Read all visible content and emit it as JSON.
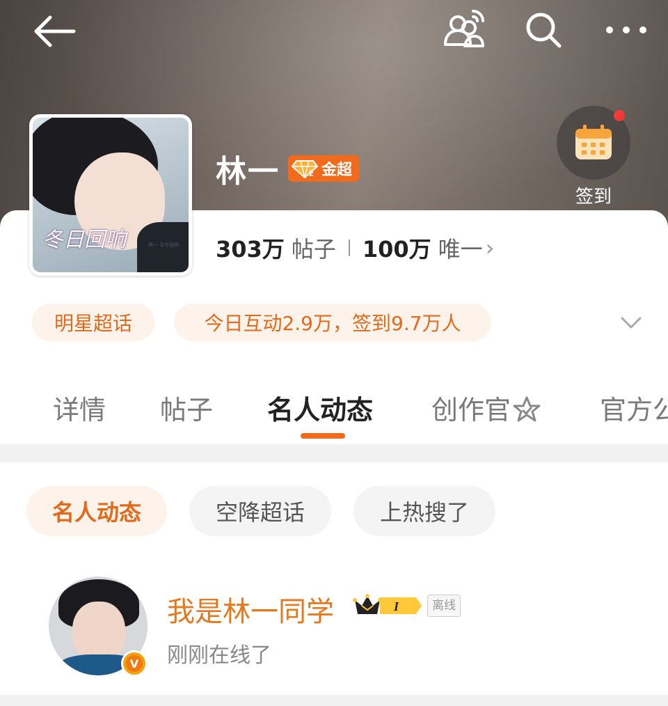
{
  "header": {
    "back_icon": "arrow-left-icon",
    "follow_icon": "users-plus-icon",
    "search_icon": "search-icon",
    "more_icon": "more-horizontal-icon"
  },
  "topic": {
    "name": "林一",
    "badge_label": "金超",
    "badge_icon": "diamond-level-icon",
    "checkin_label": "签到",
    "checkin_icon": "calendar-icon",
    "cover_title": "冬日回响",
    "cover_note": "林一 寻冬回响",
    "posts_count": "303万",
    "posts_label": "帖子",
    "members_count": "100万",
    "members_label": "唯一",
    "members_chevron": "›",
    "category_chip": "明星超话",
    "activity_chip": "今日互动2.9万，签到9.7万人"
  },
  "tabs": [
    {
      "label": "详情",
      "active": false
    },
    {
      "label": "帖子",
      "active": false
    },
    {
      "label": "名人动态",
      "active": true
    },
    {
      "label": "创作官",
      "active": false
    },
    {
      "label": "官方公",
      "active": false
    }
  ],
  "filters": [
    {
      "label": "名人动态",
      "active": true
    },
    {
      "label": "空降超话",
      "active": false
    },
    {
      "label": "上热搜了",
      "active": false
    }
  ],
  "celebrity": {
    "name": "我是林一同学",
    "level": "I",
    "level_icon": "crown-level-icon",
    "verified_mark": "V",
    "presence": "离线",
    "status": "刚刚在线了"
  },
  "colors": {
    "accent": "#f26a1b",
    "chip_bg": "#fdf3ea",
    "name_orange": "#e6781e"
  }
}
